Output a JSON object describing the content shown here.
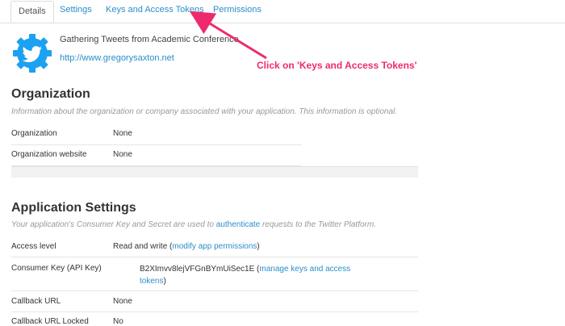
{
  "tabs": {
    "details": "Details",
    "settings": "Settings",
    "keys": "Keys and Access Tokens",
    "permissions": "Permissions"
  },
  "app": {
    "name": "Gathering Tweets from Academic Conference",
    "url": "http://www.gregorysaxton.net",
    "icon": "twitter-bird-gear-icon"
  },
  "annotation": {
    "text": "Click on 'Keys and Access Tokens'",
    "color": "#ee2a6f"
  },
  "organization": {
    "title": "Organization",
    "description": "Information about the organization or company associated with your application. This information is optional.",
    "rows": [
      {
        "label": "Organization",
        "value": "None"
      },
      {
        "label": "Organization website",
        "value": "None"
      }
    ]
  },
  "app_settings": {
    "title": "Application Settings",
    "desc_before": "Your application's Consumer Key and Secret are used to ",
    "desc_link": "authenticate",
    "desc_after": " requests to the Twitter Platform.",
    "access_level_label": "Access level",
    "access_level_value": "Read and write",
    "access_level_link": "modify app permissions",
    "consumer_key_label": "Consumer Key (API Key)",
    "consumer_key_value": "B2XImvv8lejVFGnBYmUiSec1E",
    "consumer_key_link": "manage keys and access tokens",
    "callback_url_label": "Callback URL",
    "callback_url_value": "None",
    "callback_locked_label": "Callback URL Locked",
    "callback_locked_value": "No"
  },
  "colors": {
    "link": "#2a8fc8",
    "accent": "#ee2a6f",
    "twitter_blue": "#1da1f2"
  }
}
